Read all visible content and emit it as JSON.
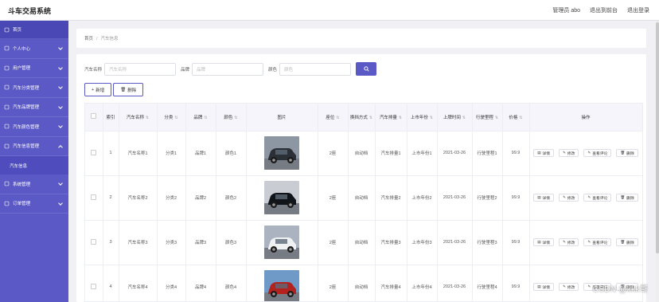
{
  "app": {
    "title": "斗车交易系统"
  },
  "top_links": [
    "管理员 abo",
    "退出到前台",
    "退出登录"
  ],
  "sidebar": {
    "items": [
      {
        "label": "首页",
        "icon": "home-icon",
        "expandable": false,
        "expanded": false
      },
      {
        "label": "个人中心",
        "icon": "user-icon",
        "expandable": true,
        "expanded": false
      },
      {
        "label": "用户管理",
        "icon": "users-icon",
        "expandable": true,
        "expanded": false
      },
      {
        "label": "汽车分类管理",
        "icon": "grid-icon",
        "expandable": true,
        "expanded": false
      },
      {
        "label": "汽车品牌管理",
        "icon": "tag-icon",
        "expandable": true,
        "expanded": false
      },
      {
        "label": "汽车颜色管理",
        "icon": "palette-icon",
        "expandable": true,
        "expanded": false
      },
      {
        "label": "汽车信息管理",
        "icon": "car-icon",
        "expandable": true,
        "expanded": true
      },
      {
        "label": "系统管理",
        "icon": "gear-icon",
        "expandable": true,
        "expanded": false
      },
      {
        "label": "订单管理",
        "icon": "order-icon",
        "expandable": true,
        "expanded": false
      }
    ],
    "sub_item": "汽车信息"
  },
  "breadcrumb": {
    "home": "首页",
    "separator": "/",
    "current": "汽车信息"
  },
  "search": {
    "fields": [
      {
        "label": "汽车名称",
        "placeholder": "汽车名称"
      },
      {
        "label": "品牌",
        "placeholder": "品牌"
      },
      {
        "label": "颜色",
        "placeholder": "颜色"
      }
    ],
    "button_icon": "search-icon"
  },
  "actions": {
    "add_label": "新增",
    "delete_label": "删除"
  },
  "table": {
    "columns": [
      "",
      "索引",
      "汽车名称",
      "分类",
      "品牌",
      "颜色",
      "图片",
      "座位",
      "换挡方式",
      "汽车排量",
      "上市年份",
      "上牌时间",
      "行驶里程",
      "价格",
      "操作"
    ],
    "sortable": [
      false,
      false,
      true,
      true,
      true,
      true,
      false,
      true,
      true,
      true,
      true,
      true,
      true,
      true,
      false
    ],
    "rows": [
      {
        "index": "1",
        "name": "汽车名称1",
        "category": "分类1",
        "brand": "品牌1",
        "color": "颜色1",
        "image": "dark-suv",
        "seats": "2座",
        "gearbox": "自动档",
        "displacement": "汽车排量1",
        "year": "上市年份1",
        "reg_date": "2021-03-26",
        "mileage": "行驶里程1",
        "price": "99.9"
      },
      {
        "index": "2",
        "name": "汽车名称2",
        "category": "分类2",
        "brand": "品牌2",
        "color": "颜色2",
        "image": "black-sedan",
        "seats": "2座",
        "gearbox": "自动档",
        "displacement": "汽车排量2",
        "year": "上市年份2",
        "reg_date": "2021-03-26",
        "mileage": "行驶里程2",
        "price": "99.9"
      },
      {
        "index": "3",
        "name": "汽车名称3",
        "category": "分类3",
        "brand": "品牌3",
        "color": "颜色3",
        "image": "white-suv",
        "seats": "2座",
        "gearbox": "自动档",
        "displacement": "汽车排量3",
        "year": "上市年份3",
        "reg_date": "2021-03-26",
        "mileage": "行驶里程3",
        "price": "99.9"
      },
      {
        "index": "4",
        "name": "汽车名称4",
        "category": "分类4",
        "brand": "品牌4",
        "color": "颜色4",
        "image": "red-jeep",
        "seats": "2座",
        "gearbox": "自动档",
        "displacement": "汽车排量4",
        "year": "上市年份4",
        "reg_date": "2021-03-26",
        "mileage": "行驶里程4",
        "price": "99.9"
      }
    ],
    "row_actions": [
      {
        "label": "详情",
        "icon": "detail-icon"
      },
      {
        "label": "修改",
        "icon": "edit-icon"
      },
      {
        "label": "查看评论",
        "icon": "comment-icon"
      },
      {
        "label": "删除",
        "icon": "trash-icon"
      }
    ]
  },
  "watermark": "CSDN @kkk哥",
  "colors": {
    "primary": "#5b59c6",
    "sidebar": "#5b59c6",
    "sidebar_active": "#4a48b5"
  }
}
